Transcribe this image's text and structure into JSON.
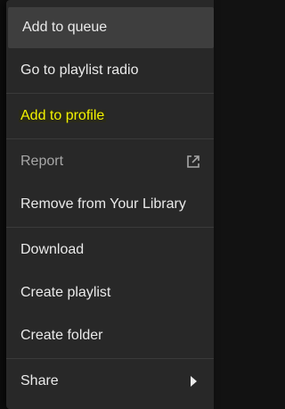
{
  "menu": {
    "items": [
      {
        "label": "Add to queue"
      },
      {
        "label": "Go to playlist radio"
      },
      {
        "label": "Add to profile"
      },
      {
        "label": "Report"
      },
      {
        "label": "Remove from Your Library"
      },
      {
        "label": "Download"
      },
      {
        "label": "Create playlist"
      },
      {
        "label": "Create folder"
      },
      {
        "label": "Share"
      }
    ]
  },
  "icons": {
    "report": "external-link-icon",
    "share": "chevron-right-icon"
  },
  "colors": {
    "menu_bg": "#282828",
    "hover_bg": "#3e3e3e",
    "text": "#eaeaea",
    "disabled_text": "#a7a7a7",
    "highlight_text": "#f3f300"
  }
}
